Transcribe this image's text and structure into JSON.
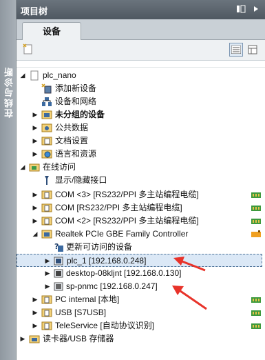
{
  "panel": {
    "title": "项目树",
    "side_label": "在线与诊断"
  },
  "tabs": [
    {
      "label": "设备"
    }
  ],
  "tree": [
    {
      "label": "plc_nano",
      "bold": false
    },
    {
      "label": "添加新设备",
      "bold": false
    },
    {
      "label": "设备和网络",
      "bold": false
    },
    {
      "label": "未分组的设备",
      "bold": true
    },
    {
      "label": "公共数据",
      "bold": false
    },
    {
      "label": "文档设置",
      "bold": false
    },
    {
      "label": "语言和资源",
      "bold": false
    },
    {
      "label": "在线访问",
      "bold": false
    },
    {
      "label": "显示/隐藏接口",
      "bold": false
    },
    {
      "label": "COM <3> [RS232/PPI 多主站编程电缆]",
      "bold": false
    },
    {
      "label": "COM [RS232/PPI 多主站编程电缆]",
      "bold": false
    },
    {
      "label": "COM <2> [RS232/PPI 多主站编程电缆]",
      "bold": false
    },
    {
      "label": "Realtek PCIe GBE Family Controller",
      "bold": false
    },
    {
      "label": "更新可访问的设备",
      "bold": false
    },
    {
      "label": "plc_1 [192.168.0.248]",
      "bold": false
    },
    {
      "label": "desktop-08kljnt [192.168.0.130]",
      "bold": false
    },
    {
      "label": "sp-pnmc [192.168.0.247]",
      "bold": false
    },
    {
      "label": "PC internal [本地]",
      "bold": false
    },
    {
      "label": "USB [S7USB]",
      "bold": false
    },
    {
      "label": "TeleService [自动协议识别]",
      "bold": false
    },
    {
      "label": "读卡器/USB 存储器",
      "bold": false
    }
  ],
  "colors": {
    "titlebar": "#4f5861",
    "selection": "#dbe8f6",
    "arrow": "#e8332a"
  }
}
